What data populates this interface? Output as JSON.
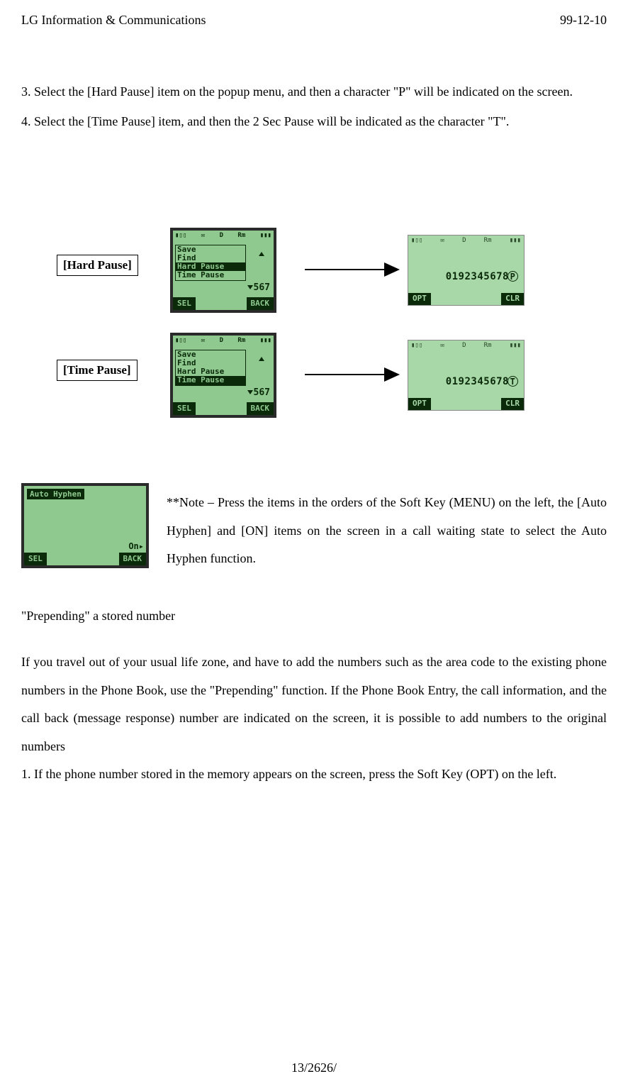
{
  "header": {
    "left": "LG Information & Communications",
    "right": "99-12-10"
  },
  "list": {
    "item3": "3.  Select the [Hard Pause] item on the popup menu, and then a character \"P\" will be indicated on the screen.",
    "item4": "4.  Select the [Time Pause] item, and then the 2 Sec Pause will be indicated as the character \"T\"."
  },
  "labels": {
    "hard_pause": "[Hard Pause]",
    "time_pause": "[Time Pause]"
  },
  "phone": {
    "status_icons": "▮▯▯  ✉  D  Rm  ▮▮▮",
    "menu": {
      "save": "Save",
      "find": "Find",
      "hard_pause": "Hard Pause",
      "time_pause": "Time Pause"
    },
    "side_number": "567",
    "softkeys": {
      "sel": "SEL",
      "back": "BACK",
      "opt": "OPT",
      "clr": "CLR"
    },
    "result": {
      "hard": "0192345678",
      "hard_suffix": "P",
      "time": "0192345678",
      "time_suffix": "T"
    },
    "auto_hyphen": {
      "title": "Auto Hyphen",
      "on": "On▸"
    }
  },
  "note_text": "**Note – Press the items in the orders of the Soft Key (MENU) on the left, the [Auto Hyphen] and [ON] items on the screen in a call waiting state to select the Auto Hyphen function.",
  "section_title": "\"Prepending\" a stored number",
  "body": {
    "intro": "If you travel out of your usual life zone, and have to add the numbers such as the area code to the existing phone numbers in the Phone Book, use the \"Prepending\" function. If the Phone Book Entry, the call information, and the call back (message response) number are indicated on the screen, it is possible to add numbers to the original numbers",
    "step1": "1.   If the phone number stored in the memory appears on the screen, press the Soft Key (OPT) on the left."
  },
  "footer": "13/2626/"
}
